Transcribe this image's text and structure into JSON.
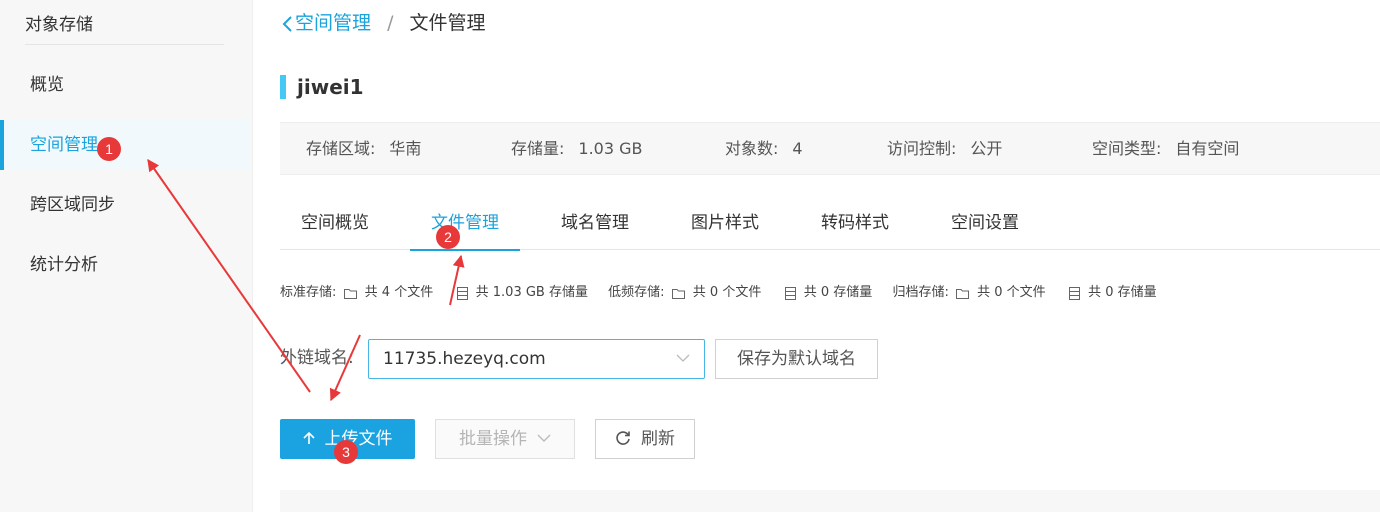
{
  "sidebar": {
    "title": "对象存储",
    "items": [
      {
        "label": "概览"
      },
      {
        "label": "空间管理"
      },
      {
        "label": "跨区域同步"
      },
      {
        "label": "统计分析"
      }
    ]
  },
  "breadcrumb": {
    "back_label": "空间管理",
    "separator": "/",
    "current": "文件管理"
  },
  "bucket": {
    "name": "jiwei1",
    "region_label": "存储区域:",
    "region_value": "华南",
    "storage_label": "存储量:",
    "storage_value": "1.03 GB",
    "objects_label": "对象数:",
    "objects_value": "4",
    "access_label": "访问控制:",
    "access_value": "公开",
    "type_label": "空间类型:",
    "type_value": "自有空间"
  },
  "tabs": [
    {
      "label": "空间概览"
    },
    {
      "label": "文件管理"
    },
    {
      "label": "域名管理"
    },
    {
      "label": "图片样式"
    },
    {
      "label": "转码样式"
    },
    {
      "label": "空间设置"
    }
  ],
  "storage_summary": {
    "standard_label": "标准存储:",
    "standard_files": "共 4 个文件",
    "standard_size": "共 1.03 GB 存储量",
    "infrequent_label": "低频存储:",
    "infrequent_files": "共 0 个文件",
    "infrequent_size": "共 0 存储量",
    "archive_label": "归档存储:",
    "archive_files": "共 0 个文件",
    "archive_size": "共 0 存储量"
  },
  "domain": {
    "label": "外链域名:",
    "selected": "11735.hezeyq.com",
    "save_default_label": "保存为默认域名"
  },
  "actions": {
    "upload_label": "上传文件",
    "batch_label": "批量操作",
    "refresh_label": "刷新"
  },
  "annotations": {
    "badges": [
      "1",
      "2",
      "3"
    ],
    "color": "#e8393a"
  },
  "colors": {
    "accent": "#1aa3dc",
    "upload_button": "#1aa3e0",
    "bucket_marker": "#46c8f5"
  }
}
